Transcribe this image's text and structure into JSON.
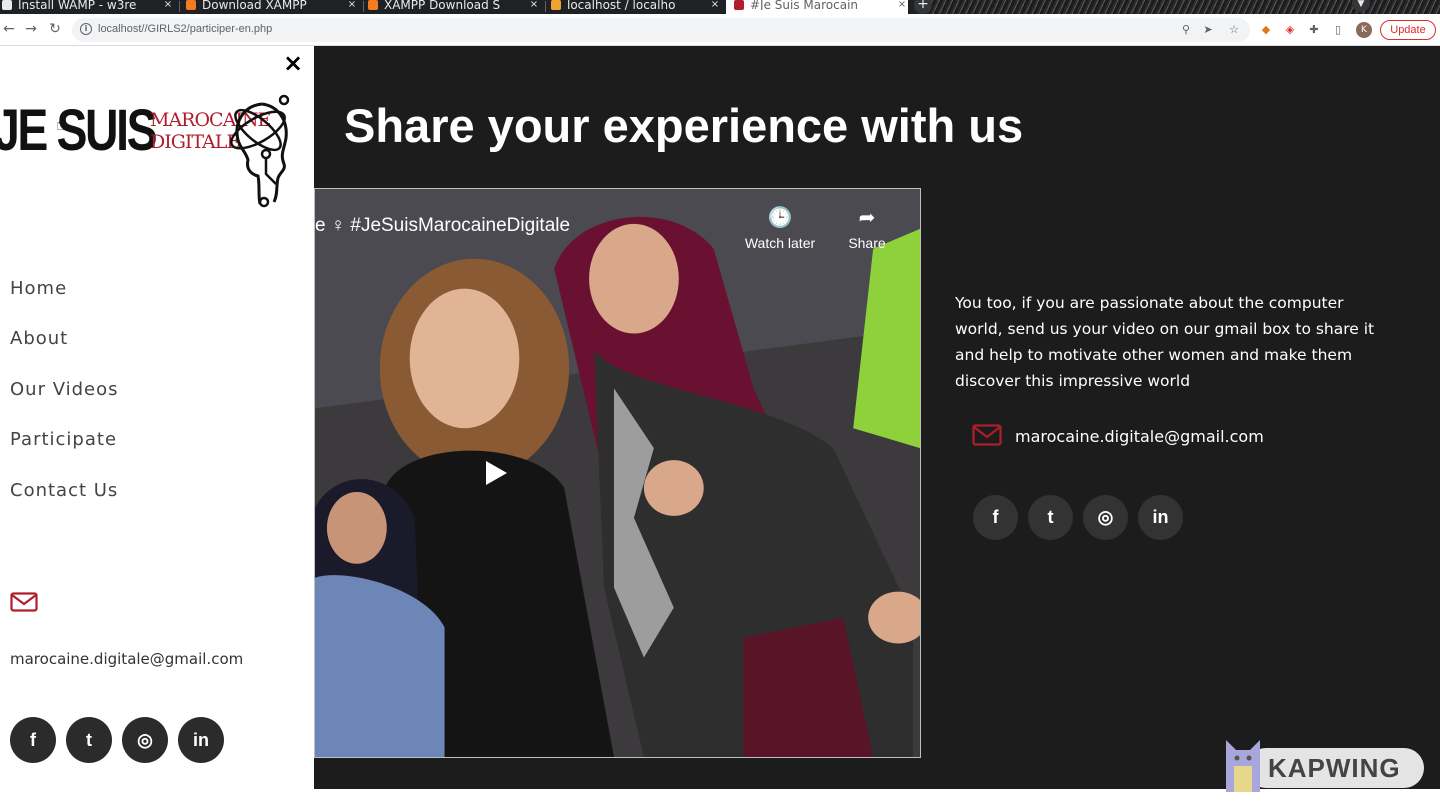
{
  "browser": {
    "tabs": [
      {
        "title": "Install WAMP - w3re",
        "favicon_color": "#e8eaed",
        "active": false
      },
      {
        "title": "Download XAMPP",
        "favicon_color": "#f37c20",
        "active": false
      },
      {
        "title": "XAMPP Download S",
        "favicon_color": "#f37c20",
        "active": false
      },
      {
        "title": "localhost / localho",
        "favicon_color": "#f0a430",
        "active": false
      },
      {
        "title": "#Je Suis Marocain",
        "favicon_color": "#b01e2e",
        "active": true
      }
    ],
    "tab_close": "×",
    "new_tab": "+",
    "url": "localhost//GIRLS2/participer-en.php",
    "update_label": "Update",
    "profile_initial": "K"
  },
  "sidebar": {
    "close": "×",
    "logo": {
      "line1": "JE SUIS",
      "line2": "MAROCAINE",
      "line3": "DIGITALE"
    },
    "nav": [
      {
        "label": "Home"
      },
      {
        "label": "About"
      },
      {
        "label": "Our Videos"
      },
      {
        "label": "Participate"
      },
      {
        "label": "Contact Us"
      }
    ],
    "email": "marocaine.digitale@gmail.com",
    "social": [
      {
        "name": "facebook-icon",
        "glyph": "f"
      },
      {
        "name": "twitter-icon",
        "glyph": "t"
      },
      {
        "name": "instagram-icon",
        "glyph": "◎"
      },
      {
        "name": "linkedin-icon",
        "glyph": "in"
      }
    ]
  },
  "main": {
    "title": "Share your experience with us",
    "video": {
      "title": "e ♀ #JeSuisMarocaineDigitale",
      "watch_later": "Watch later",
      "share": "Share"
    },
    "description": "You too, if you are passionate about the computer world, send us your video on our gmail box to share it and help to motivate other women and make them discover this impressive world",
    "email": "marocaine.digitale@gmail.com",
    "social": [
      {
        "name": "facebook-icon",
        "glyph": "f"
      },
      {
        "name": "twitter-icon",
        "glyph": "t"
      },
      {
        "name": "instagram-icon",
        "glyph": "◎"
      },
      {
        "name": "linkedin-icon",
        "glyph": "in"
      }
    ]
  },
  "watermark": {
    "text": "KAPWING"
  },
  "colors": {
    "accent_red": "#b01e2e",
    "main_bg": "#1c1c1c",
    "sidebar_bg": "#ffffff"
  }
}
